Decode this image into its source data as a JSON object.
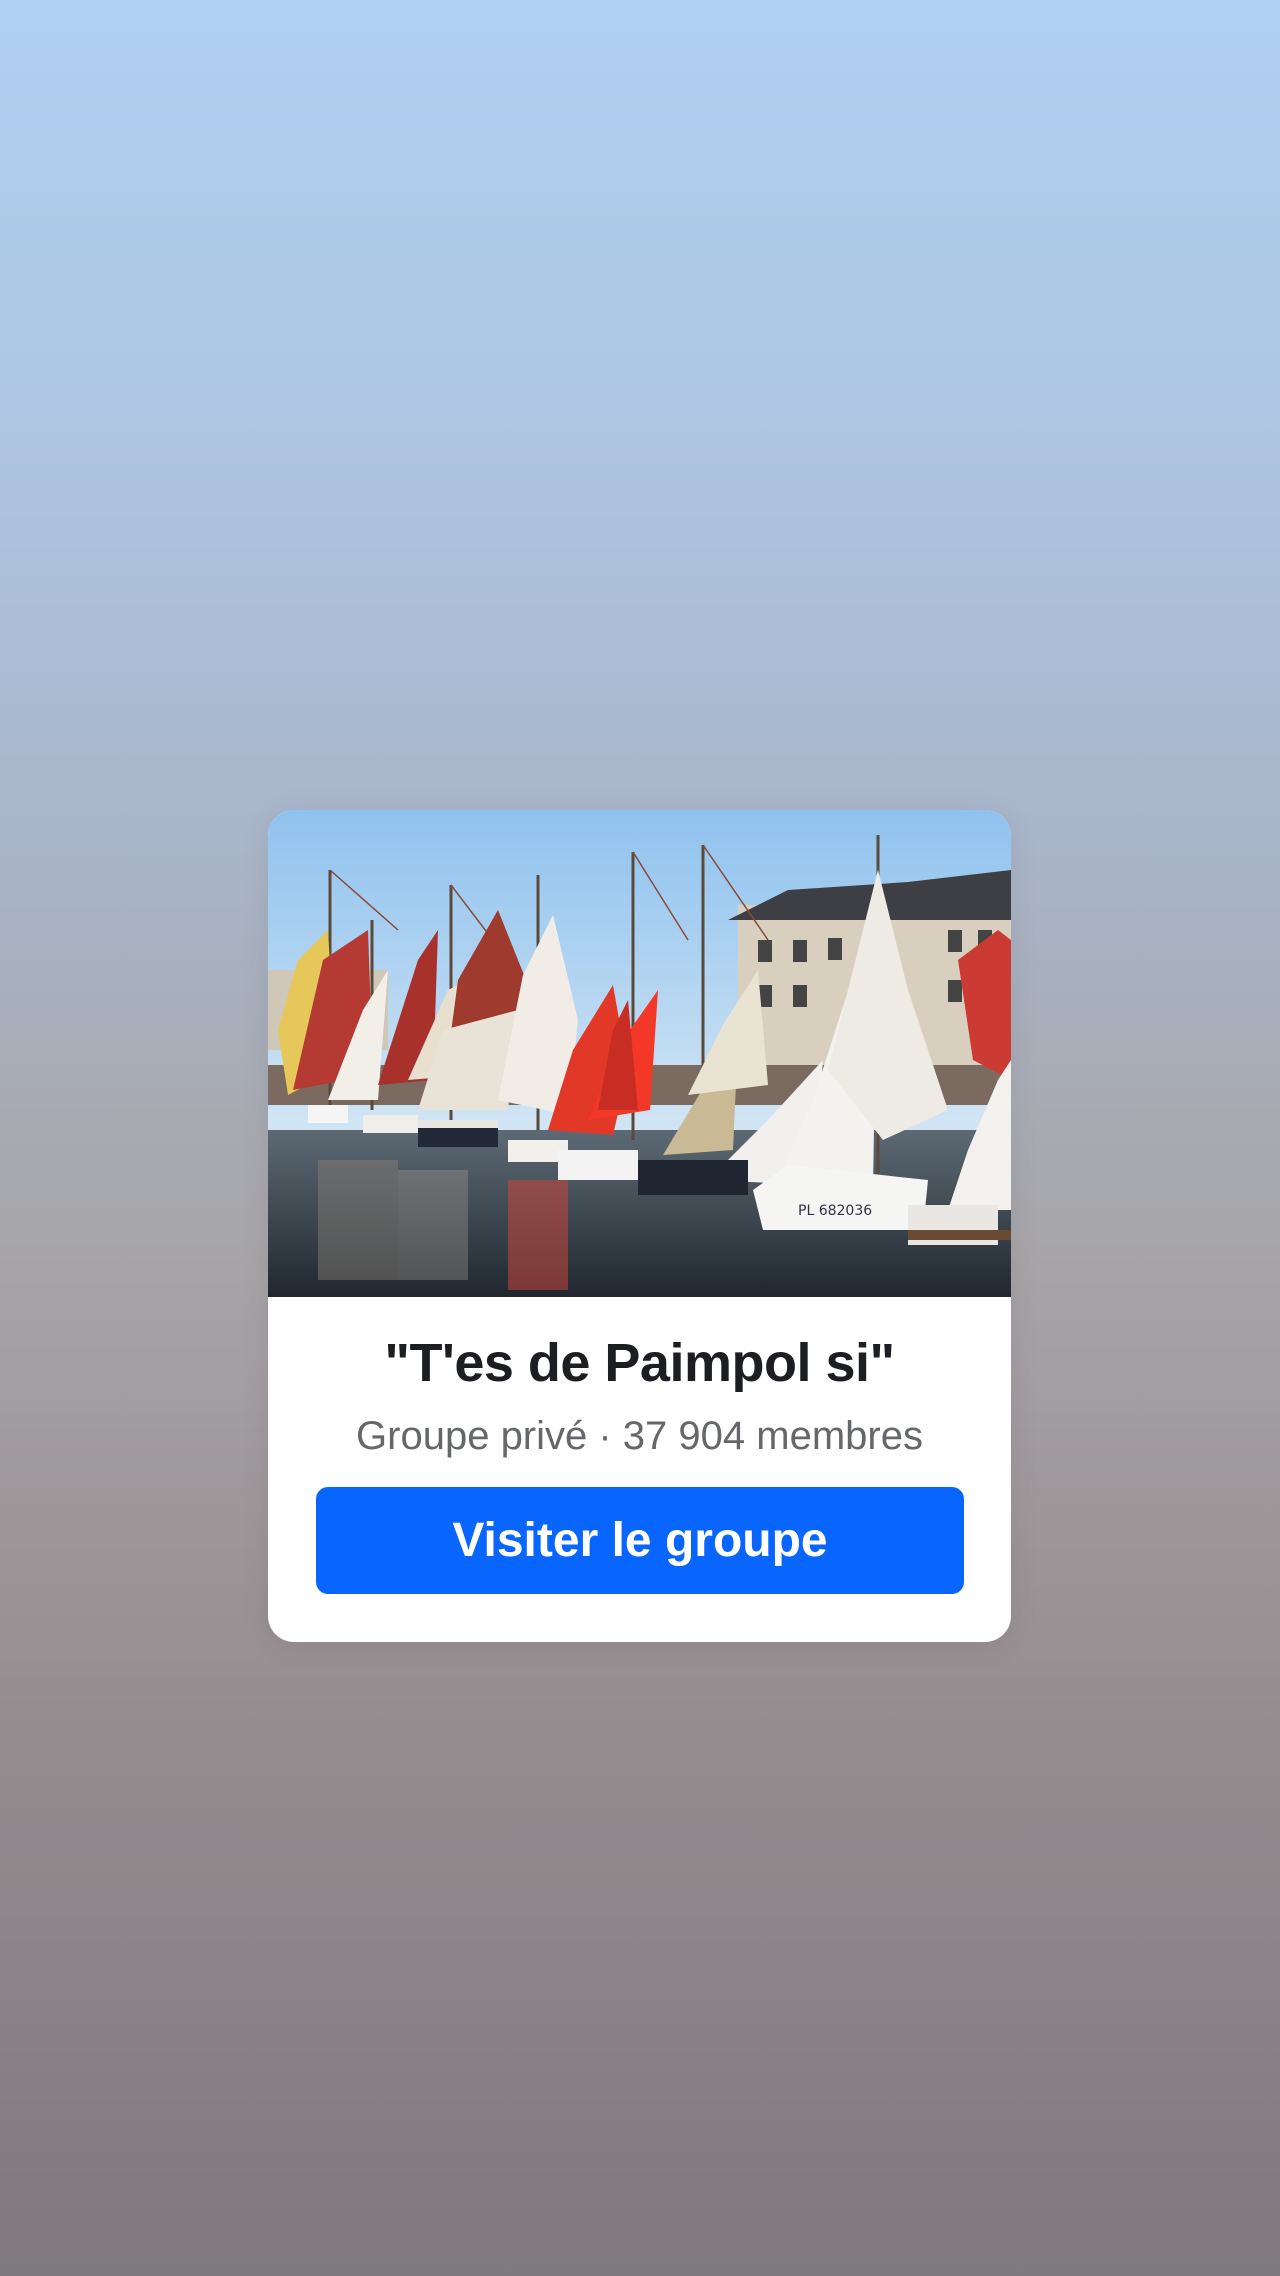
{
  "group_card": {
    "name": "\"T'es de Paimpol si\"",
    "meta": "Groupe privé · 37 904 membres",
    "visit_button_label": "Visiter le groupe",
    "cover_image_description_icon": "sailboats-harbor-photo"
  },
  "colors": {
    "button": "#0866ff",
    "title_text": "#1c1e21",
    "meta_text": "#65676b",
    "card_background": "#ffffff"
  }
}
